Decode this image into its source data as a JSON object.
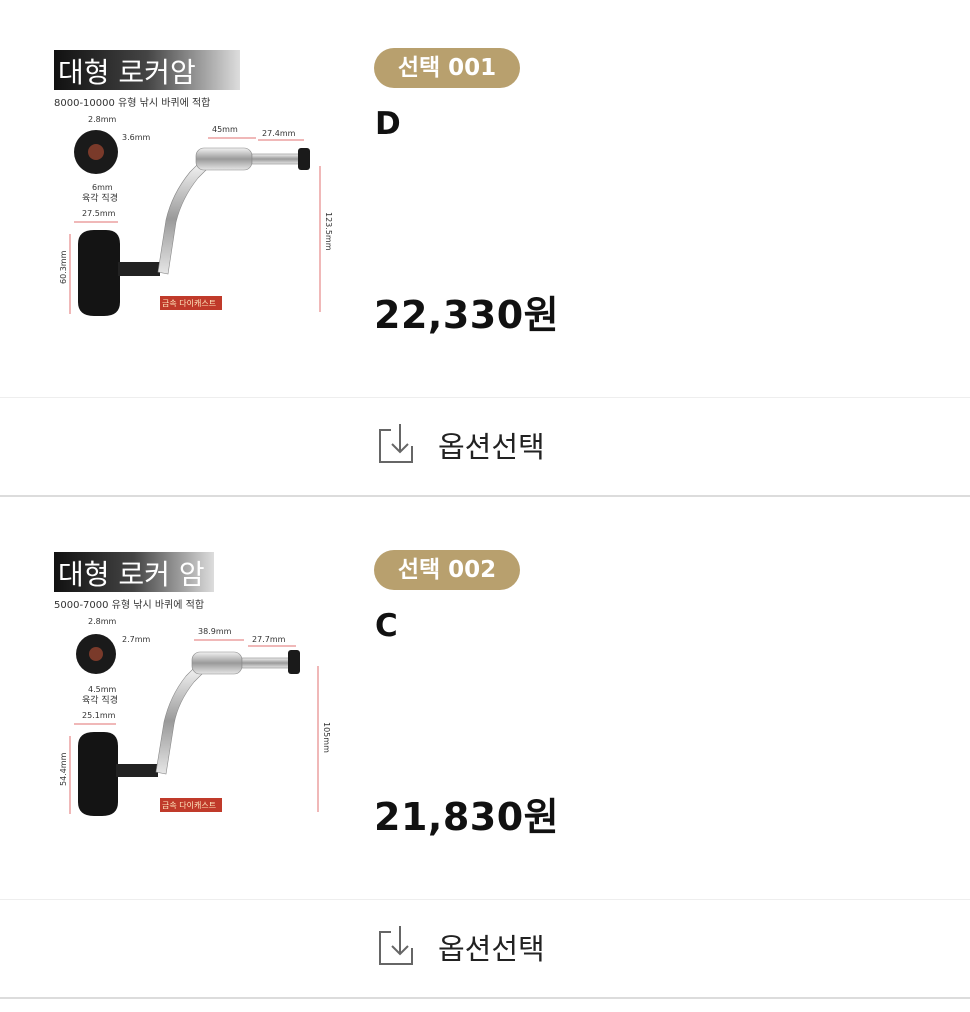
{
  "items": [
    {
      "badge": "선택 001",
      "option_name": "D",
      "price": "22,330원",
      "action_label": "옵션선택",
      "image": {
        "title": "대형 로커암",
        "subtitle": "8000-10000 유형 낚시 바퀴에 적합",
        "labels": {
          "bolt_width": "2.8mm",
          "bolt_depth": "3.6mm",
          "hex": "6mm",
          "hex_caption": "육각 직경",
          "knob_width": "27.5mm",
          "knob_height": "60.3mm",
          "arm_length": "45mm",
          "shaft_length": "27.4mm",
          "arm_height": "123.5mm",
          "tag": "금속 다이캐스트"
        }
      }
    },
    {
      "badge": "선택 002",
      "option_name": "C",
      "price": "21,830원",
      "action_label": "옵션선택",
      "image": {
        "title": "대형 로커 암",
        "subtitle": "5000-7000 유형 낚시 바퀴에 적합",
        "labels": {
          "bolt_width": "2.8mm",
          "bolt_depth": "2.7mm",
          "hex": "4.5mm",
          "hex_caption": "육각 직경",
          "knob_width": "25.1mm",
          "knob_height": "54.4mm",
          "arm_length": "38.9mm",
          "shaft_length": "27.7mm",
          "arm_height": "105mm",
          "tag": "금속 다이캐스트"
        }
      }
    }
  ],
  "colors": {
    "badge_bg": "#b8a06e",
    "divider": "#dcdcdc",
    "dimension_line": "#e07070"
  },
  "icons": {
    "action": "download-box-icon"
  }
}
